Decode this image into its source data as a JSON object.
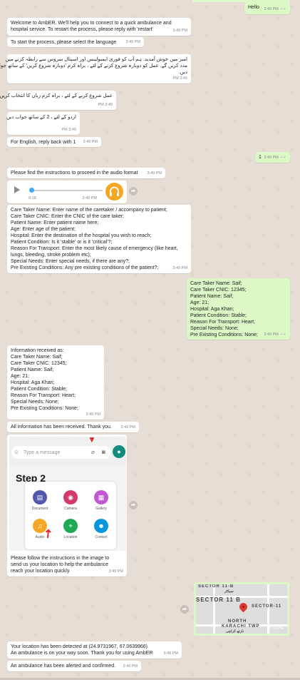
{
  "messages": {
    "hello": {
      "text": "Hello",
      "time": "3:49 PM",
      "tick": "✓✓"
    },
    "welcome": {
      "line1": "Welcome to AmbER. We'll help you to connect to a quick ambulance and",
      "line2": "hospital service. To restart the process, please reply with 'restart'",
      "time": "3:49 PM"
    },
    "start_lang": {
      "text": "To start the process, please select the language",
      "time": "3:49 PM"
    },
    "urdu_welcome": {
      "line1": "امبر میں خوش آمدید. ہم آپ کو فوری ایمبولینس اور اسپتال سروس سے رابطہ کرنے میں",
      "line2": "مدد کریں گے. عمل کو دوبارہ شروع کرنے کے لئے ، براہ کرم 'دوبارہ شروع کریں' کے ساتھ جواب",
      "line3": "دیں.",
      "time": "3:49 PM"
    },
    "urdu_select": {
      "text": "عمل شروع کرنے کے لئے ، براہ کرم زبان کا انتخاب کریں",
      "time": "3:49 PM"
    },
    "urdu_reply2": {
      "text": "اردو کے لئے ، 2 کے ساتھ جواب دیں",
      "time": "3:49 PM"
    },
    "english_reply1": {
      "text": "For English, reply back with 1",
      "time": "3:49 PM"
    },
    "reply_one": {
      "text": "1",
      "time": "3:49 PM",
      "tick": "✓✓"
    },
    "audio_instr": {
      "text": "Please find the instructions to proceed in the audio format",
      "time": "3:49 PM"
    },
    "audio": {
      "duration": "0:18",
      "time": "3:49 PM"
    },
    "form_template": {
      "lines": [
        "Care Taker Name: Enter name of the caretaker / accompany to patient;",
        "Care Taker CNIC: Enter the CNIC of the care taker;",
        "Patient Name: Enter patient name here;",
        "Age: Enter age of the patient;",
        "Hospital: Enter the destination of the hospital you wish to reach;",
        "Patient Condition: Is it 'stable' or is it 'critical'?;",
        "Reason For Transport: Enter the most likely cause of emergency (like heart,",
        "lungs, bleeding, stroke problem etc);",
        "Special Needs: Enter special needs, if there are any?;",
        "Pre Existing Conditions: Any pre existing conditions of the patient?;"
      ],
      "time": "3:49 PM"
    },
    "form_filled": {
      "lines": [
        "Care Taker Name: Saif;",
        "Care Taker CNIC: 12345;",
        "Patient Name: Saif;",
        "Age: 21;",
        "Hospital: Aga Khan;",
        "Patient Condition: Stable;",
        "Reason For Transport: Heart;",
        "Special Needs: None;",
        "Pre Existing Conditions: None;"
      ],
      "time": "3:49 PM",
      "tick": "✓✓"
    },
    "info_received": {
      "lines": [
        "Information received as:",
        " ",
        "Care Taker Name: Saif;",
        "Care Taker CNIC: 12345;",
        "Patient Name: Saif;",
        "Age: 21;",
        "Hospital: Aga Khan;",
        "Patient Condition: Stable;",
        "Reason For Transport: Heart;",
        "Special Needs: None;",
        "Pre Existing Conditions: None;"
      ],
      "time": "3:49 PM"
    },
    "all_received": {
      "text": "All information has been received. Thank you.",
      "time": "3:49 PM"
    },
    "image_instr": {
      "lines": [
        "Please follow the instructions in the image to",
        "send us your location to help the ambulance",
        "reach your location quickly."
      ],
      "time": "3:49 PM",
      "screenshot": {
        "input_placeholder": "Type a message",
        "step_title": "Step 2",
        "attach_items": [
          "Document",
          "Camera",
          "Gallery",
          "Audio",
          "Location",
          "Contact"
        ]
      }
    },
    "map": {
      "sector_top": "SECTOR 11-B",
      "sector_top_urdu": "سیکٹر",
      "sector_main": "SECTOR 11 B",
      "sector_right": "SECTOR-11",
      "north": "NORTH",
      "karachi": "KARACHI TWP",
      "karachi_urdu": "نارتھ کراچی",
      "time": "3:49 PM"
    },
    "location_detected": {
      "line1": "Your location has been detected at (24.9731967, 67.0639966)",
      "line2": "An ambulance is on your way soon. Thank you for using AmbER",
      "time": "3:49 PM"
    },
    "alerted": {
      "text": "An ambulance has been alerted and confirmed.",
      "time": "3:49 PM"
    }
  },
  "colors": {
    "incoming": "#ffffff",
    "outgoing": "#dcf8c6",
    "wallpaper": "#e6ddd4",
    "accent": "#128c7e"
  }
}
